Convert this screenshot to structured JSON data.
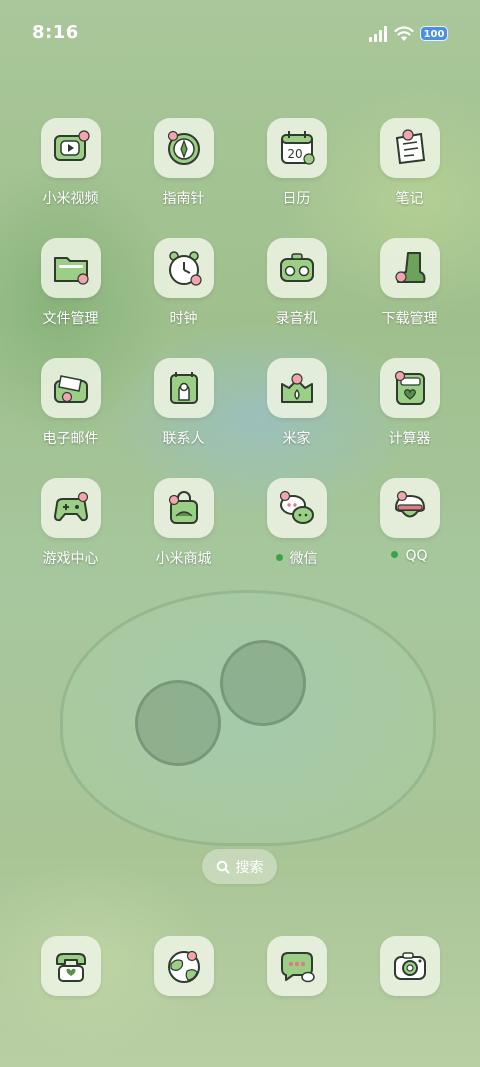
{
  "status_bar": {
    "time": "8:16",
    "battery": "100"
  },
  "apps": [
    {
      "label": "小米视频",
      "icon": "video-icon"
    },
    {
      "label": "指南针",
      "icon": "compass-icon"
    },
    {
      "label": "日历",
      "icon": "calendar-icon",
      "day": "20"
    },
    {
      "label": "笔记",
      "icon": "notes-icon"
    },
    {
      "label": "文件管理",
      "icon": "folder-icon"
    },
    {
      "label": "时钟",
      "icon": "alarm-clock-icon"
    },
    {
      "label": "录音机",
      "icon": "recorder-icon"
    },
    {
      "label": "下载管理",
      "icon": "download-boot-icon"
    },
    {
      "label": "电子邮件",
      "icon": "mail-icon"
    },
    {
      "label": "联系人",
      "icon": "contacts-icon"
    },
    {
      "label": "米家",
      "icon": "mi-home-icon"
    },
    {
      "label": "计算器",
      "icon": "calculator-icon"
    },
    {
      "label": "游戏中心",
      "icon": "gamepad-icon"
    },
    {
      "label": "小米商城",
      "icon": "shopping-bag-icon"
    },
    {
      "label": "微信",
      "icon": "wechat-icon",
      "new_dot": true
    },
    {
      "label": "QQ",
      "icon": "qq-icon",
      "new_dot": true
    }
  ],
  "search": {
    "label": "搜索"
  },
  "dock": [
    {
      "icon": "phone-icon"
    },
    {
      "icon": "browser-globe-icon"
    },
    {
      "icon": "messages-icon"
    },
    {
      "icon": "camera-icon"
    }
  ],
  "colors": {
    "icon_green": "#9ccf86",
    "icon_outline": "#2e3b2e",
    "flower_pink": "#f3a4b0",
    "new_dot": "#3aa34a"
  }
}
